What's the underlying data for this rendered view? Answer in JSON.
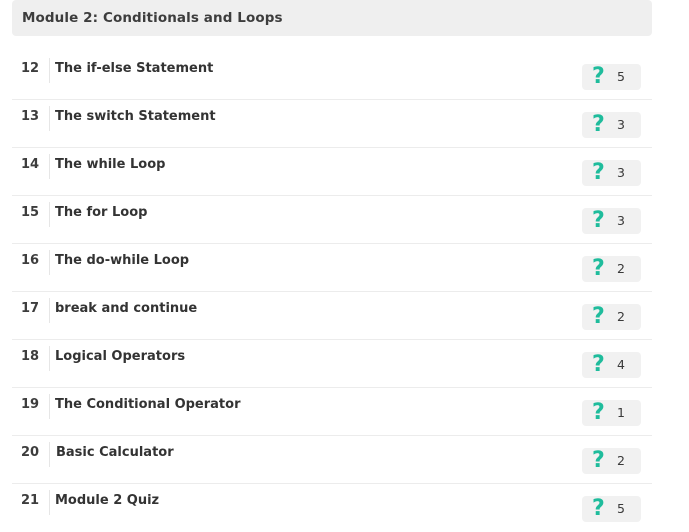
{
  "module": {
    "title": "Module 2: Conditionals and Loops",
    "accent_color": "#1fbc9c"
  },
  "lessons": [
    {
      "number": "12",
      "title": "The if-else Statement",
      "quiz_icon": "question-mark-icon",
      "quiz_count": "5"
    },
    {
      "number": "13",
      "title": "The switch Statement",
      "quiz_icon": "question-mark-icon",
      "quiz_count": "3"
    },
    {
      "number": "14",
      "title": "The while Loop",
      "quiz_icon": "question-mark-icon",
      "quiz_count": "3"
    },
    {
      "number": "15",
      "title": "The for Loop",
      "quiz_icon": "question-mark-icon",
      "quiz_count": "3"
    },
    {
      "number": "16",
      "title": "The do-while Loop",
      "quiz_icon": "question-mark-icon",
      "quiz_count": "2"
    },
    {
      "number": "17",
      "title": "break and continue",
      "quiz_icon": "question-mark-icon",
      "quiz_count": "2"
    },
    {
      "number": "18",
      "title": "Logical Operators",
      "quiz_icon": "question-mark-icon",
      "quiz_count": "4"
    },
    {
      "number": "19",
      "title": "The Conditional Operator",
      "quiz_icon": "question-mark-icon",
      "quiz_count": "1"
    },
    {
      "number": "20",
      "title": "Basic Calculator",
      "quiz_icon": "question-mark-icon",
      "quiz_count": "2"
    },
    {
      "number": "21",
      "title": "Module 2 Quiz",
      "quiz_icon": "question-mark-icon",
      "quiz_count": "5"
    }
  ]
}
